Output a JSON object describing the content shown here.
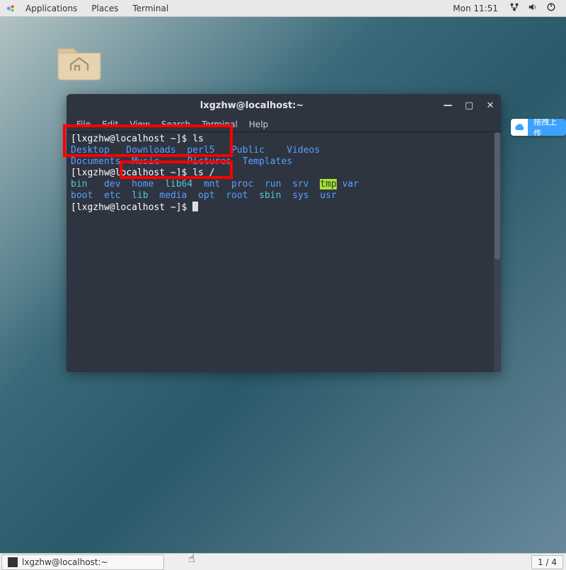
{
  "top_panel": {
    "applications": "Applications",
    "places": "Places",
    "terminal": "Terminal",
    "clock": "Mon 11:51"
  },
  "desktop": {
    "home_folder_name": "home-folder"
  },
  "terminal": {
    "title": "lxgzhw@localhost:~",
    "menus": {
      "file": "File",
      "edit": "Edit",
      "view": "View",
      "search": "Search",
      "terminal": "Terminal",
      "help": "Help"
    },
    "line1_prompt": "[lxgzhw@localhost ~]$ ",
    "line1_cmd": "ls",
    "ls_home_row1": [
      "Desktop",
      "Downloads",
      "perl5",
      "Public",
      "Videos"
    ],
    "ls_home_row2": [
      "Documents",
      "Music",
      "Pictures",
      "Templates"
    ],
    "line3_prompt": "[lxgzhw@localhost ~]$ ",
    "line3_cmd": "ls /",
    "ls_root_row1": [
      "bin",
      "dev",
      "home",
      "lib64",
      "mnt",
      "proc",
      "run",
      "srv",
      "tmp",
      "var"
    ],
    "ls_root_row2": [
      "boot",
      "etc",
      "lib",
      "media",
      "opt",
      "root",
      "sbin",
      "sys",
      "usr"
    ],
    "line_last_prompt": "[lxgzhw@localhost ~]$ "
  },
  "cloud": {
    "label": "拖拽上传"
  },
  "taskbar": {
    "active_task": "lxgzhw@localhost:~",
    "workspace": "1 / 4"
  }
}
